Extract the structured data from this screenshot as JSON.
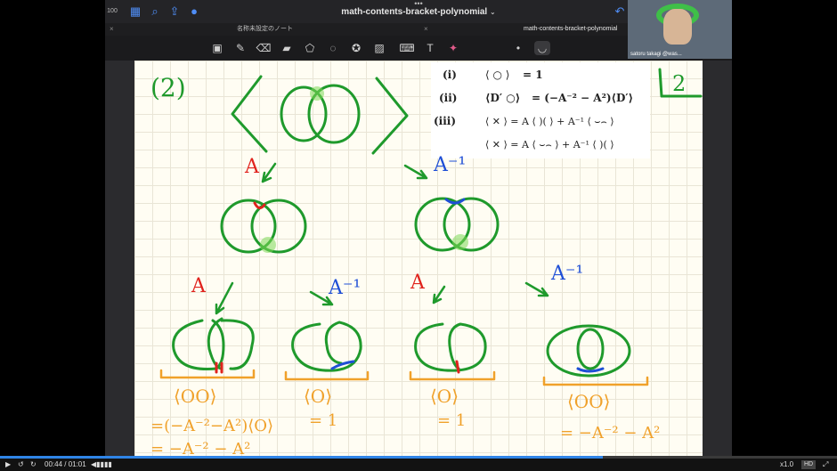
{
  "window": {
    "left_label": "100",
    "title": "math-contents-bracket-polynomial",
    "title_chevron": "⌄"
  },
  "tabs": [
    {
      "label": "名称未設定のノート"
    },
    {
      "label": "math-contents-bracket-polynomial"
    }
  ],
  "video": {
    "name": "satoru takagi @was..."
  },
  "note": {
    "problem_label": "(2)",
    "corner_label": "2",
    "rules": {
      "i_label": "(i)",
      "i_rhs": "= 1",
      "ii_label": "(ii)",
      "ii_lhs": "⟨D′ ○⟩",
      "ii_rhs": "= (−A⁻² − A²)⟨D′⟩",
      "iii_label": "(iii)",
      "iii_line1": "⟨ ✕ ⟩ = A ⟨ )( ⟩ + A⁻¹ ⟨ ⌣⌢ ⟩",
      "iii_line2": "⟨ ✕ ⟩ = A ⟨ ⌣⌢ ⟩ + A⁻¹ ⟨ )( ⟩"
    },
    "branch_left": "A",
    "branch_right": "A⁻¹",
    "sub": [
      {
        "label": "A",
        "bracket": "⟨OO⟩",
        "result1": "=(−A⁻²−A²)⟨O⟩",
        "result2": "= −A⁻² − A²"
      },
      {
        "label": "A⁻¹",
        "bracket": "⟨O⟩",
        "result1": "= 1"
      },
      {
        "label": "A",
        "bracket": "⟨O⟩",
        "result1": "= 1"
      },
      {
        "label": "A⁻¹",
        "bracket": "⟨OO⟩",
        "result1": "= −A⁻² − A²"
      }
    ]
  },
  "player": {
    "time": "00:44 / 01:01",
    "progress": 0.72,
    "speed": "x1.0",
    "quality": "HD"
  },
  "colors": {
    "green": "#1f9a2c",
    "red": "#e0231d",
    "blue": "#1f4fd6",
    "orange": "#f0a12a",
    "accent": "#4f8df5"
  }
}
